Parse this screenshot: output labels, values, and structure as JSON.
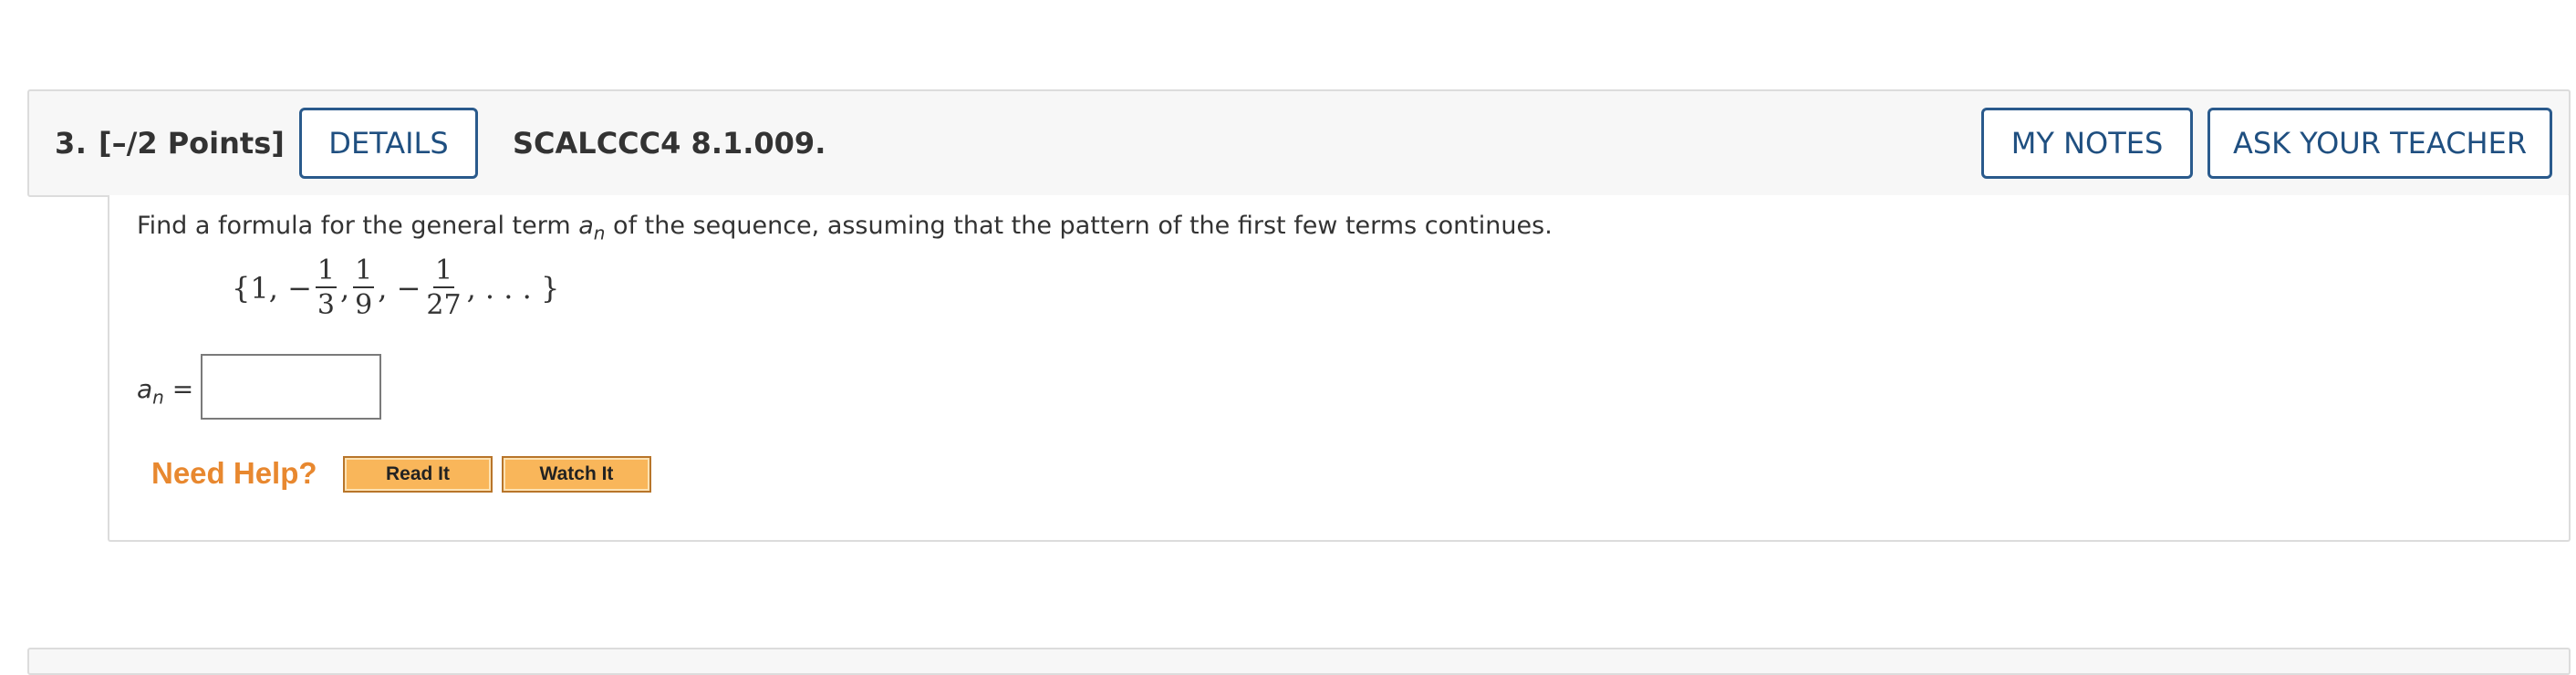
{
  "question": {
    "number": "3.",
    "points": "[–/2 Points]",
    "details_label": "DETAILS",
    "code": "SCALCCC4 8.1.009.",
    "my_notes_label": "MY NOTES",
    "ask_teacher_label": "ASK YOUR TEACHER"
  },
  "body": {
    "prompt_before": "Find a formula for the general term ",
    "prompt_var": "a",
    "prompt_sub": "n",
    "prompt_after": " of the sequence, assuming that the pattern of the first few terms continues.",
    "sequence": {
      "open": "{1, −",
      "frac1_num": "1",
      "frac1_den": "3",
      "sep1": ",",
      "frac2_num": "1",
      "frac2_den": "9",
      "sep2": ", −",
      "frac3_num": "1",
      "frac3_den": "27",
      "close": ", . . . }"
    },
    "answer_var": "a",
    "answer_sub": "n",
    "answer_eq": "=",
    "answer_value": ""
  },
  "help": {
    "label": "Need Help?",
    "read_label": "Read It",
    "watch_label": "Watch It"
  },
  "colors": {
    "button_border": "#2a5a8c",
    "button_text": "#1f4f80",
    "need_help": "#e8882f",
    "help_button_bg": "#f9b65a"
  }
}
